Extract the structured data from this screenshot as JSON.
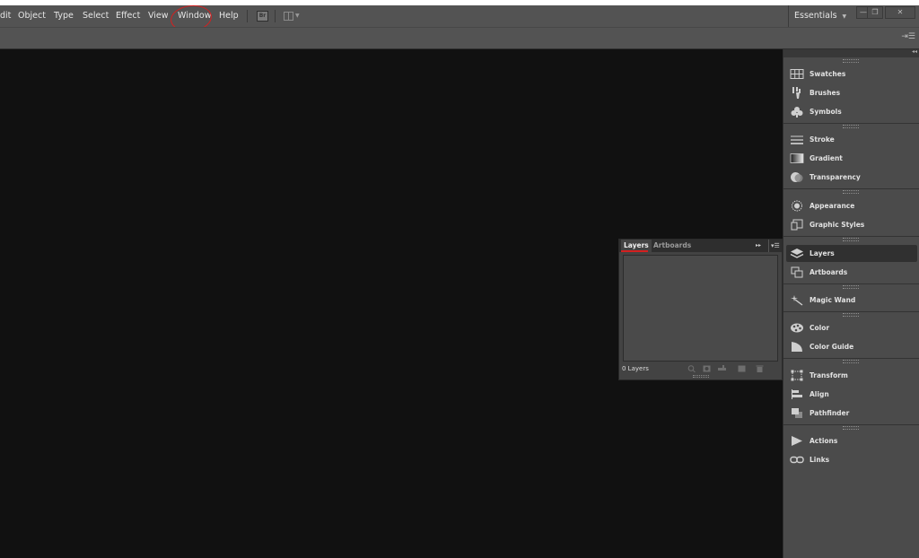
{
  "menubar": {
    "items": [
      "dit",
      "Object",
      "Type",
      "Select",
      "Effect",
      "View",
      "Window",
      "Help"
    ],
    "bridge_label": "Br",
    "annotation_color": "#d42020"
  },
  "workspace": {
    "label": "Essentials"
  },
  "window_controls": {
    "minimize": "—",
    "restore": "❐",
    "close": "✕"
  },
  "dock": {
    "items": [
      {
        "label": "Swatches",
        "icon": "swatches-icon"
      },
      {
        "label": "Brushes",
        "icon": "brushes-icon"
      },
      {
        "label": "Symbols",
        "icon": "symbols-icon"
      },
      {
        "label": "Stroke",
        "icon": "stroke-icon"
      },
      {
        "label": "Gradient",
        "icon": "gradient-icon"
      },
      {
        "label": "Transparency",
        "icon": "transparency-icon"
      },
      {
        "label": "Appearance",
        "icon": "appearance-icon"
      },
      {
        "label": "Graphic Styles",
        "icon": "graphic-styles-icon"
      },
      {
        "label": "Layers",
        "icon": "layers-icon"
      },
      {
        "label": "Artboards",
        "icon": "artboards-icon"
      },
      {
        "label": "Magic Wand",
        "icon": "magic-wand-icon"
      },
      {
        "label": "Color",
        "icon": "color-icon"
      },
      {
        "label": "Color Guide",
        "icon": "color-guide-icon"
      },
      {
        "label": "Transform",
        "icon": "transform-icon"
      },
      {
        "label": "Align",
        "icon": "align-icon"
      },
      {
        "label": "Pathfinder",
        "icon": "pathfinder-icon"
      },
      {
        "label": "Actions",
        "icon": "actions-icon"
      },
      {
        "label": "Links",
        "icon": "links-icon"
      }
    ],
    "active": "Layers"
  },
  "layers_panel": {
    "tabs": [
      "Layers",
      "Artboards"
    ],
    "active_tab": "Layers",
    "count_label": "0 Layers"
  },
  "colors": {
    "menubar": "#535353",
    "canvas": "#111111",
    "dock": "#4b4b4b",
    "highlight": "#d42020"
  }
}
